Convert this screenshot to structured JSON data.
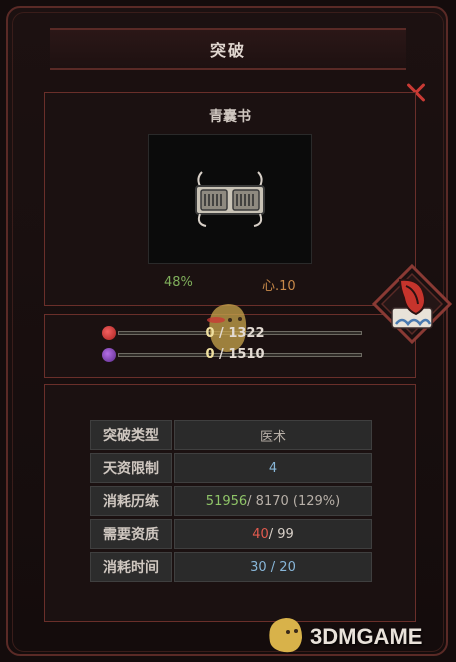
{
  "header": {
    "title": "突破"
  },
  "item": {
    "name": "青囊书",
    "percent_text": "48%",
    "heart_text": "心.10",
    "icon": "scroll-book-icon"
  },
  "bars": [
    {
      "current": "0",
      "sep": " / ",
      "max": "1322",
      "color": "#d84040",
      "icon": "red-skull-icon"
    },
    {
      "current": "0",
      "sep": " / ",
      "max": "1510",
      "color": "#9a50d0",
      "icon": "purple-skull-icon"
    }
  ],
  "stats": [
    {
      "label": "突破类型",
      "value": "医术"
    },
    {
      "label": "天资限制",
      "value": "4"
    },
    {
      "label": "消耗历练",
      "value_green": "51956",
      "value_rest": " / 8170 (129%)"
    },
    {
      "label": "需要资质",
      "value_red": "40",
      "value_rest": " / 99"
    },
    {
      "label": "消耗时间",
      "value": "30 / 20"
    }
  ],
  "watermark": {
    "text": "3DMGAME"
  },
  "colors": {
    "frame": "#5a2a26",
    "accent_red": "#c93a34",
    "green": "#8fc468",
    "blue": "#88b6d8"
  }
}
